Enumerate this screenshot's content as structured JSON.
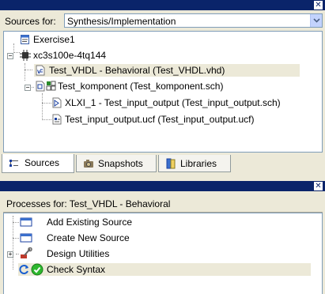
{
  "sources_panel": {
    "sources_for_label": "Sources for:",
    "sources_for_value": "Synthesis/Implementation",
    "tree": [
      {
        "label": "Exercise1",
        "icon": "project-icon"
      },
      {
        "label": "xc3s100e-4tq144",
        "icon": "chip-icon"
      },
      {
        "label": "Test_VHDL - Behavioral (Test_VHDL.vhd)",
        "icon": "vhdl-file-icon"
      },
      {
        "label": "Test_komponent (Test_komponent.sch)",
        "icon": "schematic-icon"
      },
      {
        "label": "XLXI_1 - Test_input_output (Test_input_output.sch)",
        "icon": "schematic-file-icon"
      },
      {
        "label": "Test_input_output.ucf (Test_input_output.ucf)",
        "icon": "ucf-file-icon"
      }
    ],
    "tabs": [
      {
        "label": "Sources",
        "icon": "sources-tab-icon"
      },
      {
        "label": "Snapshots",
        "icon": "snapshots-tab-icon"
      },
      {
        "label": "Libraries",
        "icon": "libraries-tab-icon"
      }
    ]
  },
  "processes_panel": {
    "title_label": "Processes for: Test_VHDL - Behavioral",
    "items": [
      {
        "label": "Add Existing Source",
        "icon": "window-icon"
      },
      {
        "label": "Create New Source",
        "icon": "window-icon"
      },
      {
        "label": "Design Utilities",
        "icon": "tools-icon"
      },
      {
        "label": "Check Syntax",
        "icon": "check-icon"
      }
    ]
  },
  "colors": {
    "titlebar": "#0a246a",
    "selection": "#ece9d8",
    "check_green": "#2eb82e"
  }
}
